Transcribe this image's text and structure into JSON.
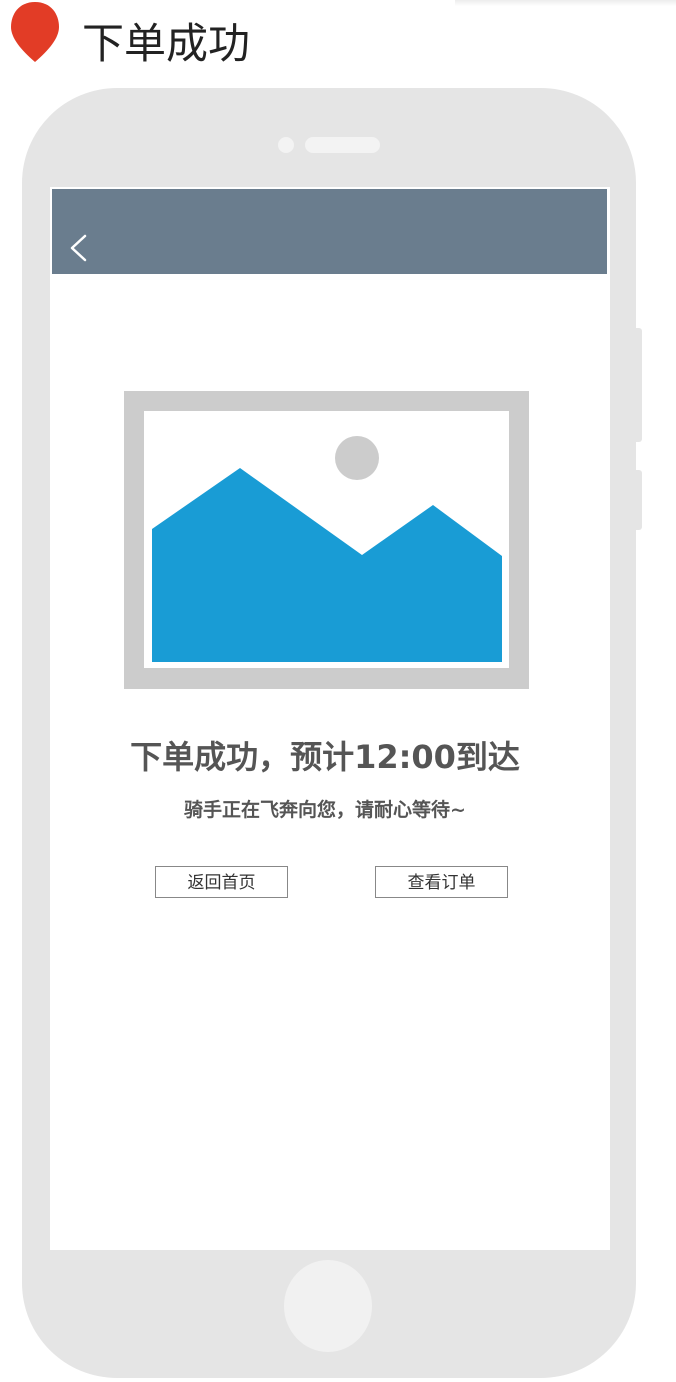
{
  "page": {
    "title": "下单成功"
  },
  "colors": {
    "pin": "#e23c26",
    "phone_frame": "#e5e5e5",
    "navbar": "#6a7d8e",
    "image_frame": "#cccccc",
    "mountains": "#199cd5",
    "text": "#555555"
  },
  "screen": {
    "navbar": {
      "back_icon": "chevron-left-icon"
    },
    "image": {
      "icon": "image-placeholder-icon"
    },
    "headline": "下单成功，预计12:00到达",
    "subline": "骑手正在飞奔向您，请耐心等待~",
    "buttons": {
      "home_label": "返回首页",
      "orders_label": "查看订单"
    }
  }
}
